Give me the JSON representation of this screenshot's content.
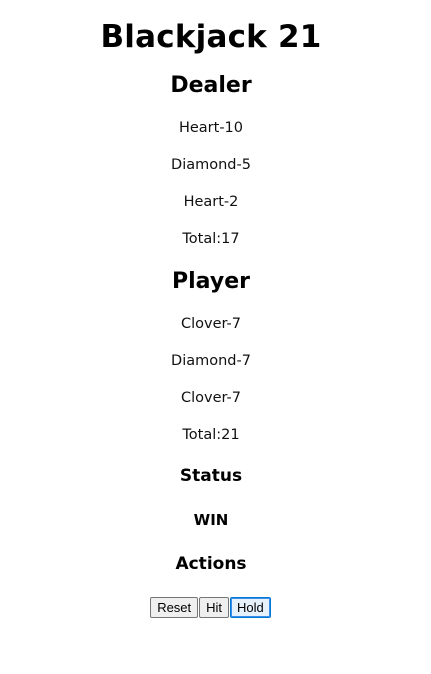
{
  "app": {
    "title": "Blackjack 21"
  },
  "dealer": {
    "heading": "Dealer",
    "cards": [
      "Heart-10",
      "Diamond-5",
      "Heart-2"
    ],
    "total": "Total:17"
  },
  "player": {
    "heading": "Player",
    "cards": [
      "Clover-7",
      "Diamond-7",
      "Clover-7"
    ],
    "total": "Total:21"
  },
  "status": {
    "heading": "Status",
    "value": "WIN"
  },
  "actions": {
    "heading": "Actions",
    "reset_label": "Reset",
    "hit_label": "Hit",
    "hold_label": "Hold",
    "focused": "hold"
  }
}
